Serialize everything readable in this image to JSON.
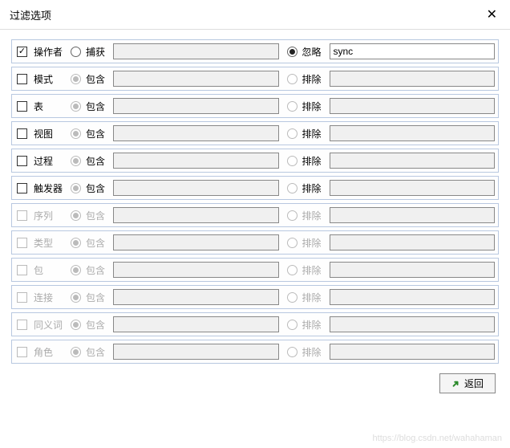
{
  "window": {
    "title": "过滤选项"
  },
  "labels": {
    "include": "包含",
    "exclude": "排除",
    "capture": "捕获",
    "ignore": "忽略"
  },
  "rows": [
    {
      "id": "operator",
      "label": "操作者",
      "checked": true,
      "opt1": "capture",
      "opt2": "ignore",
      "selected": 2,
      "val1": "",
      "val2": "sync",
      "enabled": true
    },
    {
      "id": "schema",
      "label": "模式",
      "checked": false,
      "opt1": "include",
      "opt2": "exclude",
      "selected": 1,
      "val1": "",
      "val2": "",
      "enabled": true
    },
    {
      "id": "table",
      "label": "表",
      "checked": false,
      "opt1": "include",
      "opt2": "exclude",
      "selected": 1,
      "val1": "",
      "val2": "",
      "enabled": true
    },
    {
      "id": "view",
      "label": "视图",
      "checked": false,
      "opt1": "include",
      "opt2": "exclude",
      "selected": 1,
      "val1": "",
      "val2": "",
      "enabled": true
    },
    {
      "id": "proc",
      "label": "过程",
      "checked": false,
      "opt1": "include",
      "opt2": "exclude",
      "selected": 1,
      "val1": "",
      "val2": "",
      "enabled": true
    },
    {
      "id": "trigger",
      "label": "触发器",
      "checked": false,
      "opt1": "include",
      "opt2": "exclude",
      "selected": 1,
      "val1": "",
      "val2": "",
      "enabled": true
    },
    {
      "id": "sequence",
      "label": "序列",
      "checked": false,
      "opt1": "include",
      "opt2": "exclude",
      "selected": 1,
      "val1": "",
      "val2": "",
      "enabled": false
    },
    {
      "id": "type",
      "label": "类型",
      "checked": false,
      "opt1": "include",
      "opt2": "exclude",
      "selected": 1,
      "val1": "",
      "val2": "",
      "enabled": false
    },
    {
      "id": "package",
      "label": "包",
      "checked": false,
      "opt1": "include",
      "opt2": "exclude",
      "selected": 1,
      "val1": "",
      "val2": "",
      "enabled": false
    },
    {
      "id": "link",
      "label": "连接",
      "checked": false,
      "opt1": "include",
      "opt2": "exclude",
      "selected": 1,
      "val1": "",
      "val2": "",
      "enabled": false
    },
    {
      "id": "synonym",
      "label": "同义词",
      "checked": false,
      "opt1": "include",
      "opt2": "exclude",
      "selected": 1,
      "val1": "",
      "val2": "",
      "enabled": false
    },
    {
      "id": "role",
      "label": "角色",
      "checked": false,
      "opt1": "include",
      "opt2": "exclude",
      "selected": 1,
      "val1": "",
      "val2": "",
      "enabled": false
    }
  ],
  "footer": {
    "back": "返回"
  },
  "watermark": "https://blog.csdn.net/wahahaman"
}
